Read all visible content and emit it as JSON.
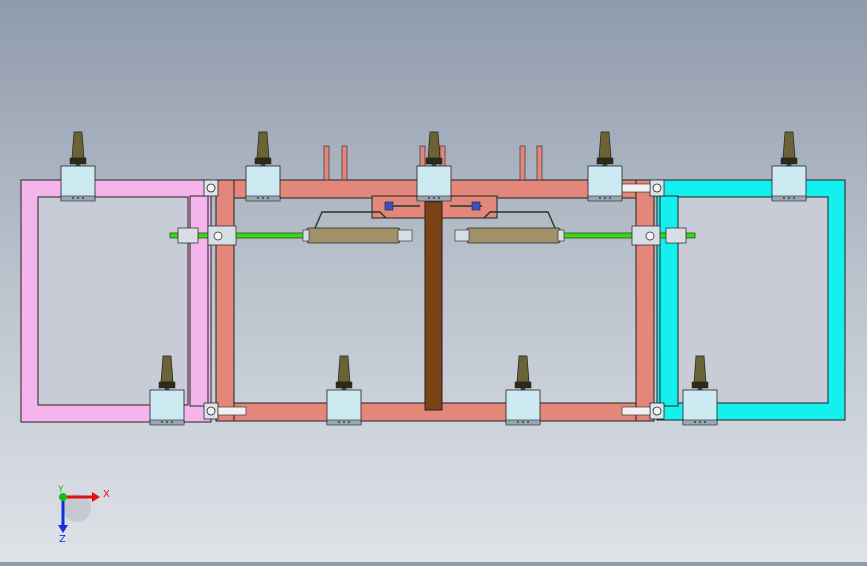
{
  "viewport": {
    "background_top": "#8f9aab",
    "background_bottom": "#dfe3e8"
  },
  "colors": {
    "left_frame": "#f6b4ec",
    "center_frame": "#e3877b",
    "right_frame": "#14f0ee",
    "clamp_block": "#cdeaf3",
    "clamp_handle": "#6b6335",
    "cylinder": "#a0916b",
    "rod": "#3fd11b",
    "post": "#7a4215"
  },
  "triad": {
    "x_label": "X",
    "y_label": "Y",
    "z_label": "Z",
    "x_color": "#e01010",
    "y_color": "#10c010",
    "z_color": "#1030e0"
  }
}
